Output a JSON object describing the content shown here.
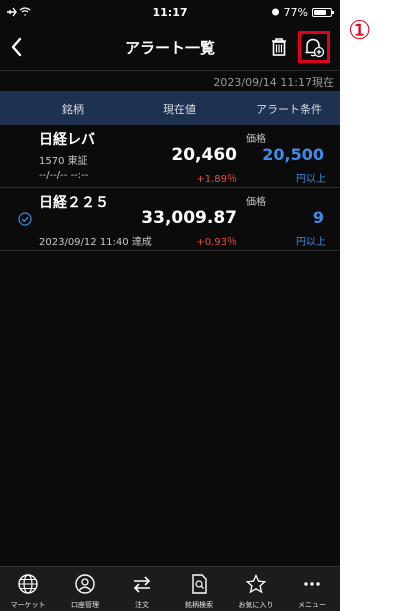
{
  "status_bar": {
    "time": "11:17",
    "battery": "77%",
    "battery_level": 0.77
  },
  "nav": {
    "title": "アラート一覧"
  },
  "timestamp": "2023/09/14 11:17現在",
  "table_header": {
    "name": "銘柄",
    "price": "現在値",
    "condition": "アラート条件"
  },
  "rows": [
    {
      "name": "日経レバ",
      "code": "1570  東証",
      "updated": "--/--/-- --:--",
      "price": "20,460",
      "change": "+1.89％",
      "cond_label": "価格",
      "cond_value": "20,500",
      "cond_unit": "円以上"
    },
    {
      "name": "日経２２５",
      "updated": "2023/09/12 11:40 達成",
      "price": "33,009.87",
      "change": "+0.93％",
      "cond_label": "価格",
      "cond_value": "9",
      "cond_unit": "円以上"
    }
  ],
  "tabs": [
    {
      "label": "マーケット",
      "icon": "globe-icon"
    },
    {
      "label": "口座管理",
      "icon": "user-icon"
    },
    {
      "label": "注文",
      "icon": "swap-arrows-icon"
    },
    {
      "label": "銘柄検索",
      "icon": "document-search-icon"
    },
    {
      "label": "お気に入り",
      "icon": "star-icon"
    },
    {
      "label": "メニュー",
      "icon": "more-dots-icon"
    }
  ],
  "callout": "①",
  "colors": {
    "accent_blue": "#3f8be8",
    "up_red": "#f04848",
    "header_bg": "#1f3150",
    "highlight": "#e0001b"
  }
}
